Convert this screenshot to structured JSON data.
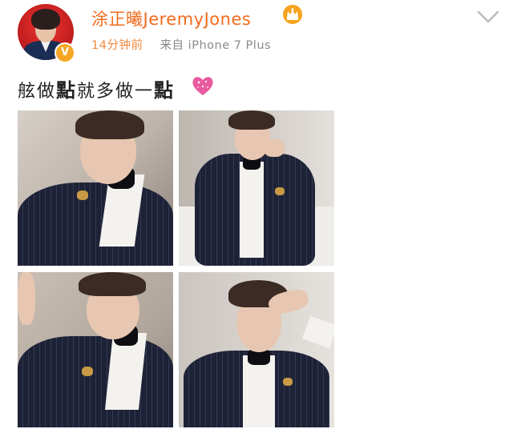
{
  "post": {
    "author": {
      "name": "涂正曦JeremyJones",
      "verified_mark": "V",
      "avatar_icon": "avatar-photo",
      "badge_icon": "crown-badge-icon"
    },
    "meta": {
      "time": "14分钟前",
      "source": "来自 iPhone 7 Plus"
    },
    "text": {
      "part1": "舷做",
      "bold1": "點",
      "part2": "就多做一",
      "bold2": "點",
      "emoji_icon": "sparkle-heart-icon"
    },
    "photos": [
      {
        "name": "photo-1"
      },
      {
        "name": "photo-2"
      },
      {
        "name": "photo-3"
      },
      {
        "name": "photo-4"
      }
    ],
    "menu_icon": "chevron-down-icon",
    "colors": {
      "username": "#f26b1d",
      "time": "#f0883c",
      "meta": "#8a8a8a",
      "verified": "#f5a623",
      "heart": "#e85aa0"
    }
  }
}
